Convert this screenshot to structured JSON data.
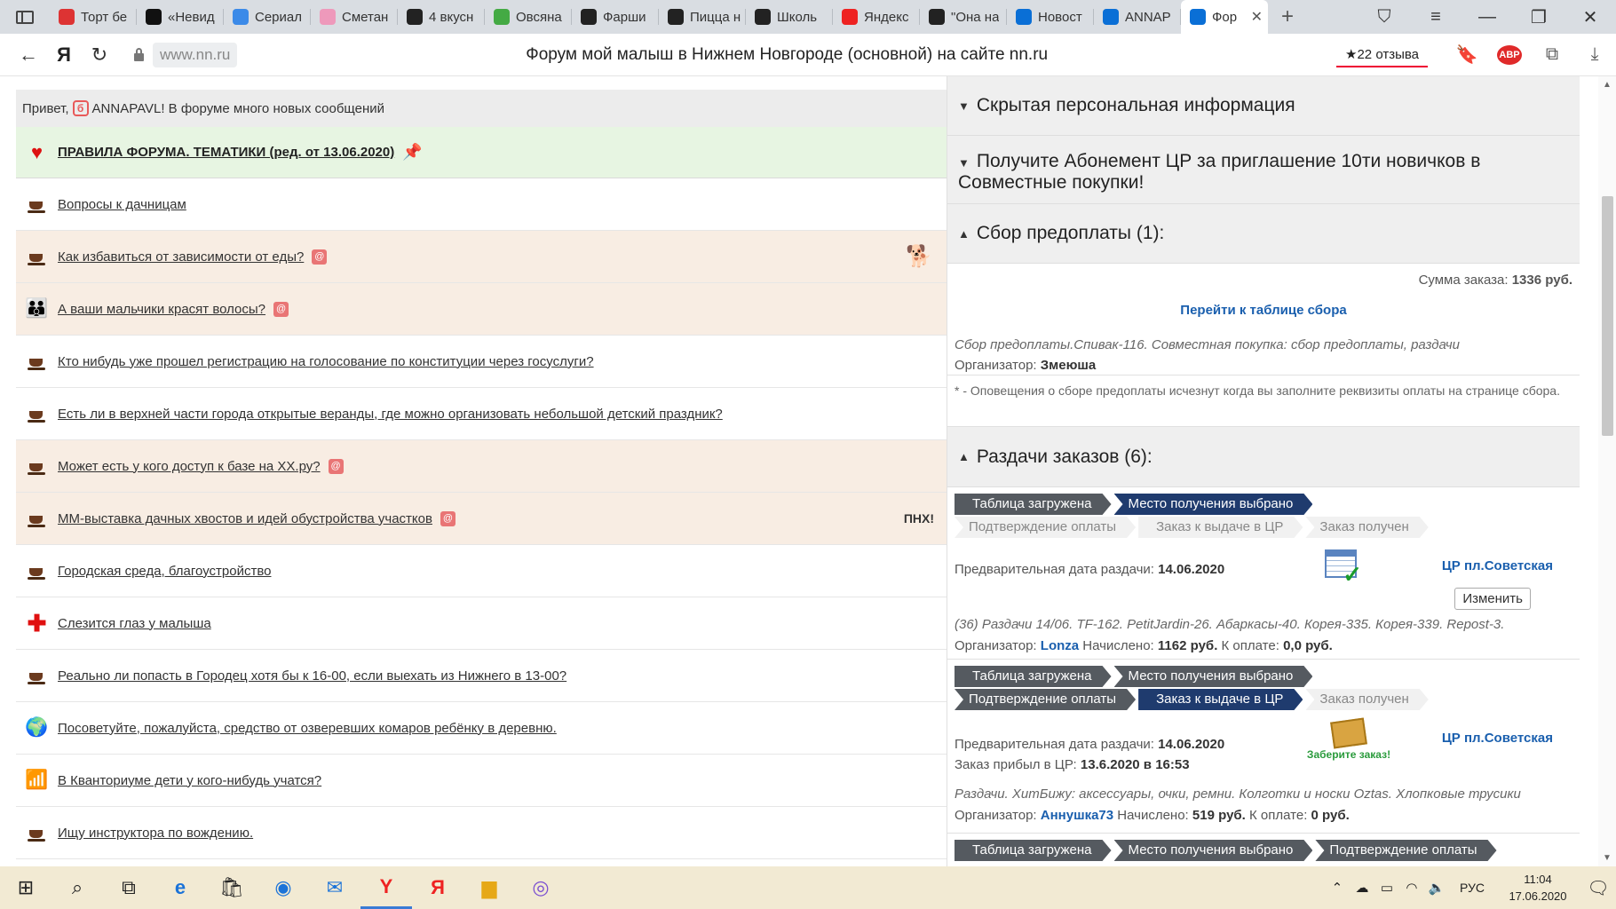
{
  "browser": {
    "tabs": [
      {
        "label": "Торт бе",
        "color": "#d33"
      },
      {
        "label": "«Невид",
        "color": "#111"
      },
      {
        "label": "Сериал",
        "color": "#3b8ae8"
      },
      {
        "label": "Сметан",
        "color": "#e9b"
      },
      {
        "label": "4 вкусн",
        "color": "#222"
      },
      {
        "label": "Овсяна",
        "color": "#4a4"
      },
      {
        "label": "Фарши",
        "color": "#222"
      },
      {
        "label": "Пицца н",
        "color": "#222"
      },
      {
        "label": "Школь",
        "color": "#222"
      },
      {
        "label": "Яндекс",
        "color": "#e22"
      },
      {
        "label": "\"Она на",
        "color": "#222"
      },
      {
        "label": "Новост",
        "color": "#0a6fd6"
      },
      {
        "label": "ANNAP",
        "color": "#0a6fd6"
      },
      {
        "label": "Фор",
        "color": "#0a6fd6",
        "active": true
      }
    ],
    "favicon_letters": {
      "dr": "DR",
      "ya": "Я"
    },
    "domain": "www.nn.ru",
    "page_title": "Форум мой малыш в Нижнем Новгороде (основной) на сайте nn.ru",
    "reviews": "★22 отзыва",
    "adblock": "ABP"
  },
  "forum": {
    "greeting_prefix": "Привет,",
    "greeting_icon": "б",
    "greeting_rest": "ANNAPAVL! В форуме много новых сообщений",
    "rules_link": "ПРАВИЛА ФОРУМА. ТЕМАТИКИ (ред. от 13.06.2020)",
    "badge": "@",
    "topics": [
      {
        "title": "Вопросы к дачницам",
        "icon": "cup",
        "hl": false,
        "badge": false,
        "trail": ""
      },
      {
        "title": "Как избавиться от зависимости от еды?",
        "icon": "cup",
        "hl": true,
        "badge": true,
        "trail": "🐕"
      },
      {
        "title": "А ваши мальчики красят волосы?",
        "icon": "people",
        "hl": true,
        "badge": true,
        "trail": ""
      },
      {
        "title": "Кто нибудь уже прошел регистрацию на голосование по конституции через госуслуги?",
        "icon": "cup",
        "hl": false,
        "badge": false,
        "trail": ""
      },
      {
        "title": "Есть ли в верхней части города открытые веранды, где можно организовать небольшой детский праздник?",
        "icon": "cup",
        "hl": false,
        "badge": false,
        "trail": ""
      },
      {
        "title": "Может есть у кого доступ к базе на XX.ру?",
        "icon": "cup",
        "hl": true,
        "badge": true,
        "trail": ""
      },
      {
        "title": "ММ-выставка дачных хвостов и идей обустройства участков",
        "icon": "cup",
        "hl": true,
        "badge": true,
        "trail": "ПНХ!"
      },
      {
        "title": "Городская среда, благоустройство",
        "icon": "cup",
        "hl": false,
        "badge": false,
        "trail": ""
      },
      {
        "title": "Слезится глаз у малыша",
        "icon": "cross",
        "hl": false,
        "badge": false,
        "trail": ""
      },
      {
        "title": "Реально ли попасть в Городец хотя бы к 16-00, если выехать из Нижнего в 13-00?",
        "icon": "cup",
        "hl": false,
        "badge": false,
        "trail": ""
      },
      {
        "title": "Посоветуйте, пожалуйста, средство от озверевших комаров ребёнку в деревню.",
        "icon": "globe",
        "hl": false,
        "badge": false,
        "trail": ""
      },
      {
        "title": "В Кванториуме дети у кого-нибудь учатся?",
        "icon": "chart",
        "hl": false,
        "badge": false,
        "trail": ""
      },
      {
        "title": "Ищу инструктора по вождению.",
        "icon": "cup",
        "hl": false,
        "badge": false,
        "trail": ""
      }
    ]
  },
  "panel": {
    "hidden_info": "Скрытая персональная информация",
    "promo": "Получите Абонемент ЦР за приглашение 10ти новичков в Совместные покупки!",
    "prepay_header": "Сбор предоплаты (1):",
    "order_sum_label": "Сумма заказа:",
    "order_sum_value": "1336 руб.",
    "go_table": "Перейти к таблице сбора",
    "prepay_desc": "Сбор предоплаты.Спивак-116. Совместная покупка: сбор предоплаты, раздачи",
    "organizer_label": "Организатор:",
    "prepay_org": "Змеюша",
    "prepay_note": "* - Оповещения о сборе предоплаты исчезнут когда вы заполните реквизиты оплаты на странице сбора.",
    "dist_header": "Раздачи заказов (6):",
    "steps": [
      "Таблица загружена",
      "Место получения выбрано",
      "Подтверждение оплаты",
      "Заказ к выдаче в ЦР",
      "Заказ получен"
    ],
    "prelim_date_label": "Предварительная дата раздачи:",
    "accrued_label": "Начислено:",
    "to_pay_label": "К оплате:",
    "arrived_label": "Заказ прибыл в ЦР:",
    "change_btn": "Изменить",
    "pickup_text": "Заберите заказ!",
    "d1": {
      "date": "14.06.2020",
      "place": "ЦР пл.Советская",
      "desc": "(36) Раздачи 14/06. TF-162. PetitJardin-26. Абаркасы-40. Корея-335. Корея-339. Repost-3.",
      "org": "Lonza",
      "accrued": "1162 руб.",
      "to_pay": "0,0 руб."
    },
    "d2": {
      "date": "14.06.2020",
      "arrived": "13.6.2020 в 16:53",
      "place": "ЦР пл.Советская",
      "desc": "Раздачи. ХитБижу: аксессуары, очки, ремни. Колготки и носки Oztas. Хлопковые трусики",
      "org": "Аннушка73",
      "accrued": "519 руб.",
      "to_pay": "0 руб."
    }
  },
  "taskbar": {
    "lang": "РУС",
    "time": "11:04",
    "date": "17.06.2020"
  }
}
